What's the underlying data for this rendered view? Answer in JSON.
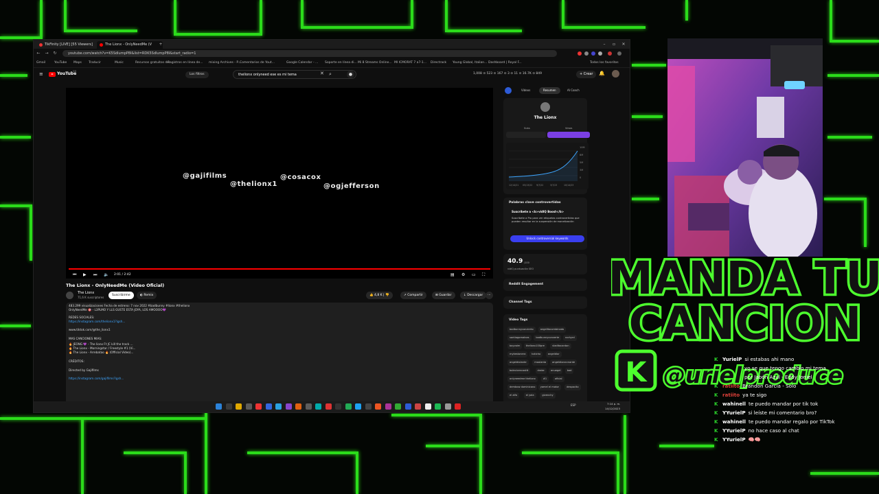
{
  "browser": {
    "tabs": [
      {
        "label": "TikFinity [LIVE] [55 Viewers]"
      },
      {
        "label": "The Lionx - OnlyNeedMe (V"
      }
    ],
    "url": "youtube.com/watch?v=K5SdlumpP8I&list=RDK5SdlumpP8I&start_radio=1",
    "bookmarks": [
      "Gmail",
      "YouTube",
      "Maps",
      "Traducir",
      "Music",
      "Recursos gratuitos de...",
      "Registros en línea de...",
      "mixing Archives - P...",
      "Comentarios de Yout...",
      "Google Calendar - ...",
      "Soporte en línea di...",
      "Mi 8 Streams Online...",
      "MI ICMORAT 7 a7-1...",
      "Directrack",
      "Young Global, Italian...",
      "Dashboard | Royal F..."
    ],
    "all_bookmarks": "Todos los favoritos"
  },
  "youtube": {
    "brand": "YouTube",
    "country": "CO",
    "filter_label": "Los filtros",
    "search_query": "thelionx onlyneed ese es mi tema",
    "stats": "1,008 ⊙ 523 ⊙ 167 ⊙ 3 ⊙ 11 ⊙ 16.7K ⊙ 849",
    "create_label": "Crear",
    "notif_count": "9+"
  },
  "video": {
    "overlay_handles": [
      "@gajifilms",
      "@thelionx1",
      "@cosacox",
      "@ogjefferson"
    ],
    "time": "2:01 / 2:42",
    "title": "The Lionx - OnlyNeedMe (Video Oficial)",
    "channel": "The Lionx",
    "subscribers": "71,6 K suscriptores",
    "subscribe_label": "Suscribirme",
    "remix_label": "Remix",
    "likes": "4,8 K",
    "share_label": "Compartir",
    "save_label": "Guardar",
    "download_label": "Descargar",
    "description": [
      {
        "text": "483.299 visualizaciones  Fecha de estreno: 7 nov 2022  #badbunny #lionx #thelionx",
        "link": false
      },
      {
        "text": "OnlyNeedMe 🎯 - L3PLMO Y LLS GUSTE ESTA JOYA, LOS AMOOOO💜",
        "link": false
      },
      {
        "text": "REDES SOCIALES:",
        "link": false
      },
      {
        "text": "https://instagram.com/thelionx1?igsh...",
        "link": true
      },
      {
        "text": "www.tiktok.com/@the_lionx1",
        "link": false
      },
      {
        "text": "MAS CANCIONES MIAS:",
        "link": false
      },
      {
        "text": "🔥 JEONG 💜 - The lionx Ft JC kill the track ...",
        "link": false
      },
      {
        "text": "🔥 The Lionx - Morningstar / Freestyle #1 (Vi...",
        "link": false
      },
      {
        "text": "🔥 The Lionx - Arrebatao 🔥 (Official Video)...",
        "link": false
      },
      {
        "text": "CRÉDITOS:",
        "link": false
      },
      {
        "text": "Directed by Gajifilms",
        "link": false
      },
      {
        "text": "https://instagram.com/gajifilms?igsh...",
        "link": true
      }
    ]
  },
  "sidebar": {
    "tabs": [
      "Videos",
      "Resumen",
      "AI Coach"
    ],
    "channel_name": "The Lionx",
    "toggle": [
      "Subs",
      "Views"
    ],
    "chart_labels": [
      "10M",
      "8M",
      "5M",
      "3M",
      "0"
    ],
    "chart_dates": [
      "12/14/21",
      "05/13/22",
      "9/7/22",
      "3/7/23",
      "10/14/23"
    ],
    "keywords_title": "Palabras clave controvertidas",
    "boost_title": "Suscríbete a <b>vidIQ Boost</b>",
    "boost_text": "Suscríbete a Pro para ver etiquetas controvertidas que pueden resultar en la suspensión de monetización",
    "unlock_label": "Unlock controversial keywords",
    "score": "40.9",
    "score_suffix": "/100",
    "score_caption": "vidIQ puntuación SEO",
    "reddit_label": "Reddit Engagement",
    "channel_tags_label": "Channel Tags",
    "video_tags_label": "Video Tags",
    "video_tags": [
      "badbunnyconcierto",
      "angelitocombinado",
      "santiagomalnas",
      "badbunnyconverte",
      "rochyrd",
      "bayvoim",
      "thelionx100pre",
      "vladitocanton",
      "mykestonera",
      "tokicho",
      "angeldior",
      "angeldiolante",
      "moolanta",
      "angeldiorzccnante",
      "bolecicencosttt",
      "drake",
      "anuegel",
      "bad",
      "onlyneedme thelionx",
      "#1",
      "oficial",
      "dembow dominicano",
      "yamel el motor",
      "despacito",
      "el alfa",
      "el yala",
      "givenchy"
    ]
  },
  "overlay": {
    "banner_line1": "MANDA TU",
    "banner_line2": "CANCION",
    "banner_handle": "@urielproduce",
    "banner_badge": "K"
  },
  "chat": [
    {
      "user": "YurielP",
      "msg": "si estabas ahi mano",
      "red": false
    },
    {
      "user": "",
      "msg": "yo se que tengo cambio mi tema",
      "red": false
    },
    {
      "user": "",
      "msg": "por Jabón Azul - Eddy Joniel",
      "red": false
    },
    {
      "user": "ratiito",
      "msg": "Brandon Garcia - Solo",
      "red": true
    },
    {
      "user": "ratiito",
      "msg": "ya te sigo",
      "red": true
    },
    {
      "user": "wahinell",
      "msg": "te puedo mandar por tik tok",
      "red": false
    },
    {
      "user": "YYurielP",
      "msg": "si leíste mi comentario bro?",
      "red": false
    },
    {
      "user": "wahinell",
      "msg": "te puedo mandar regalo por TikTok",
      "red": false
    },
    {
      "user": "YYurielP",
      "msg": "no hace caso al chat",
      "red": false
    },
    {
      "user": "YYurielP",
      "msg": "🧠🧠",
      "red": false
    }
  ],
  "taskbar": {
    "lang": "ESP",
    "time": "7:14 p. m.",
    "date": "14/12/2023"
  },
  "colors": {
    "neon_green": "#33ff22",
    "yt_red": "#ff0000",
    "vidiq_purple": "#7b3fe4",
    "unlock_blue": "#3a3ff0"
  }
}
